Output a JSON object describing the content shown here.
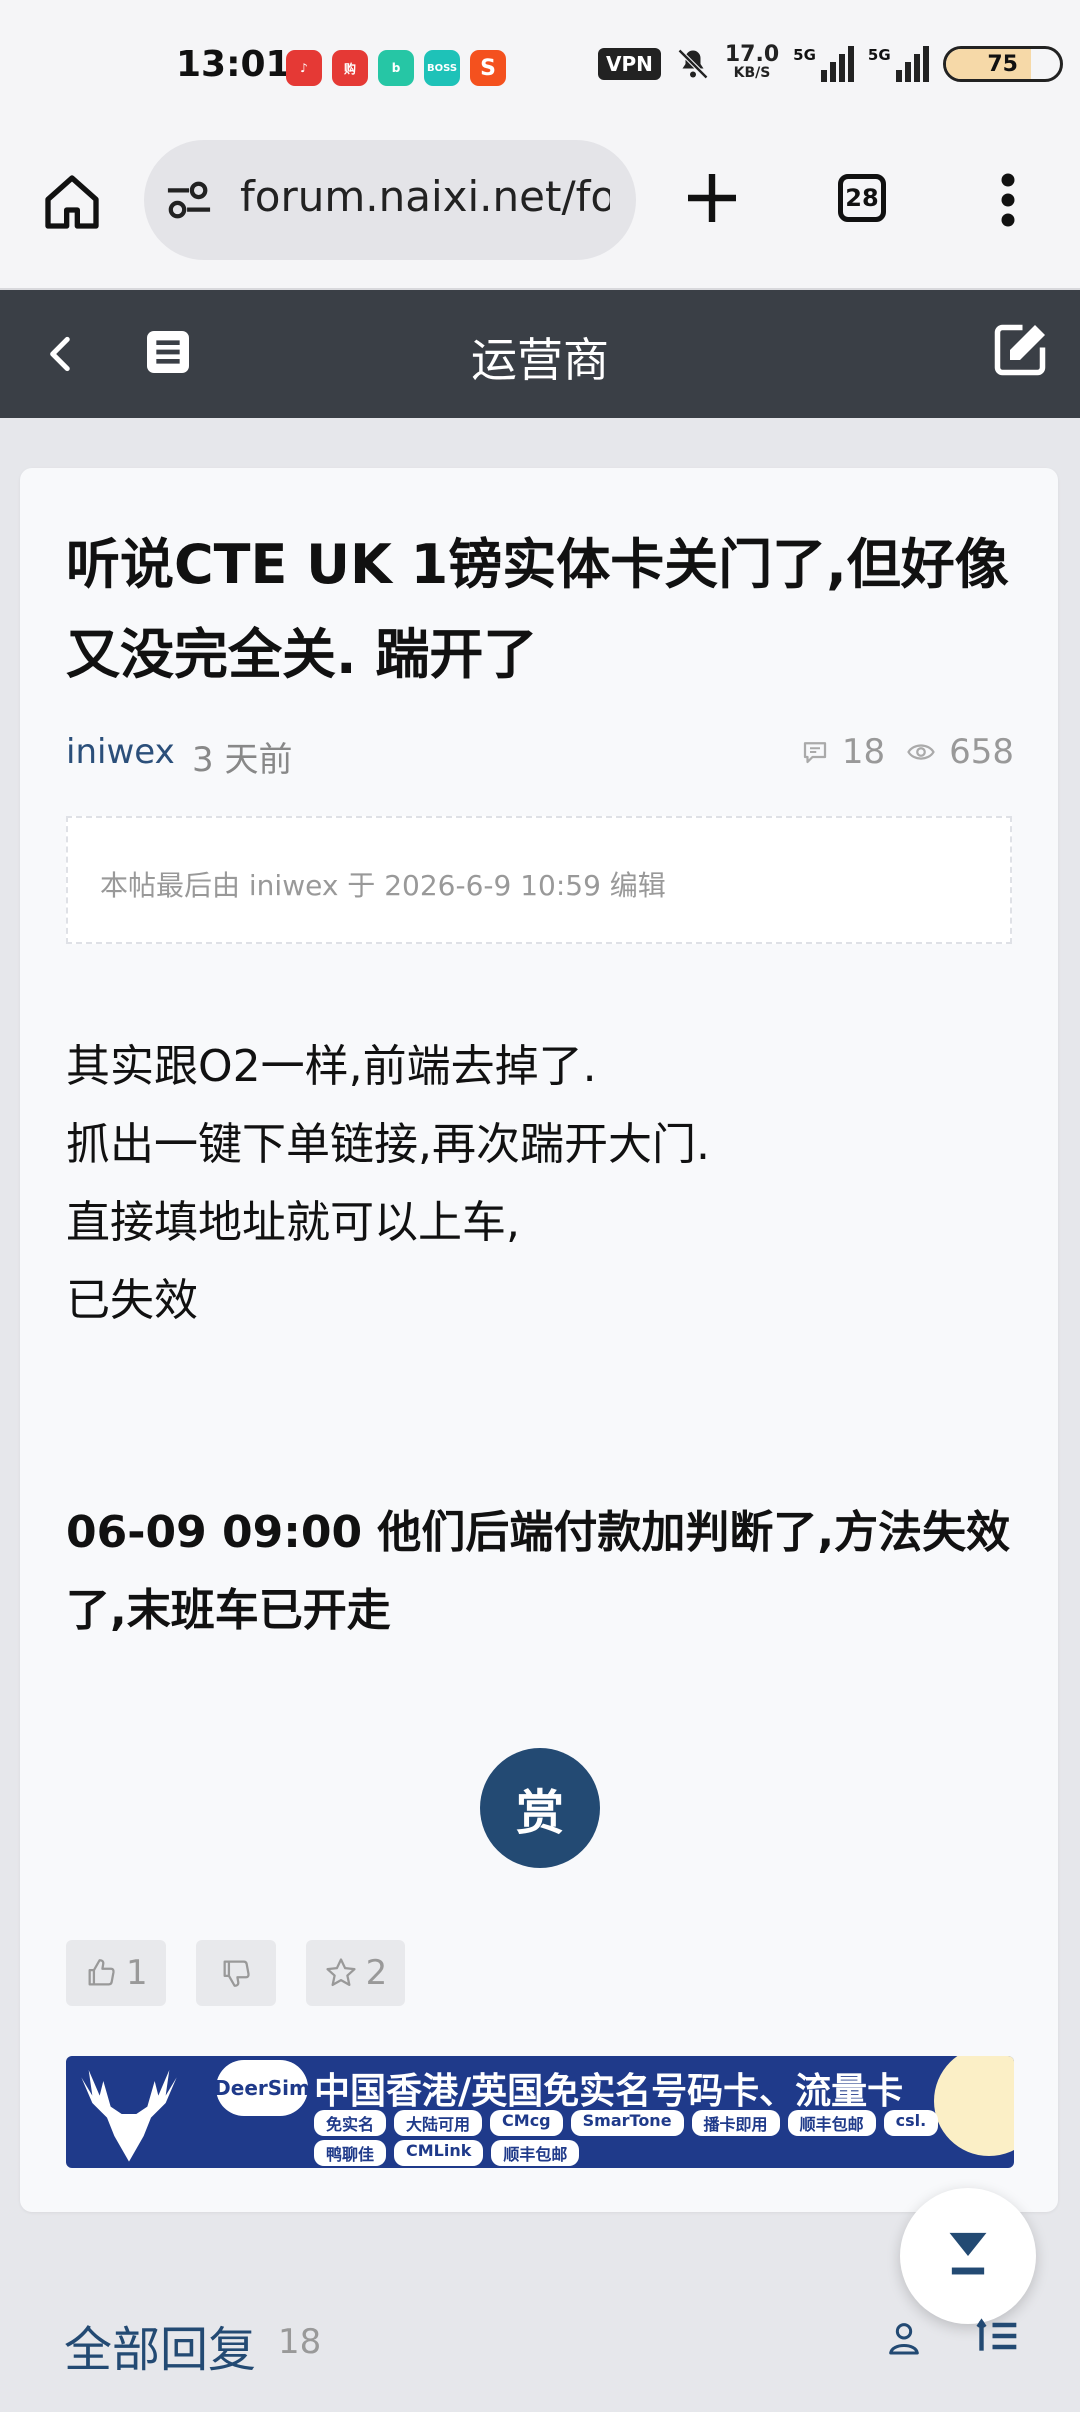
{
  "status_bar": {
    "time": "13:01",
    "apps": [
      {
        "icon": "music-app-icon",
        "color": "#e53935",
        "label": "♪"
      },
      {
        "icon": "shopping-app-icon",
        "color": "#e53935",
        "label": "购"
      },
      {
        "icon": "bilibili-app-icon",
        "color": "#26c6a5",
        "label": "b"
      },
      {
        "icon": "boss-zhipin-app-icon",
        "color": "#1ec2b8",
        "label": "BOSS"
      },
      {
        "icon": "sogou-app-icon",
        "color": "#f4511e",
        "label": "S"
      }
    ],
    "vpn": "VPN",
    "speed_value": "17.0",
    "speed_unit": "KB/S",
    "signal1_label": "5G",
    "signal2_label": "5G",
    "battery": "75",
    "battery_fraction": 0.75
  },
  "browser": {
    "url": "forum.naixi.net/fo",
    "tab_count": "28"
  },
  "forum_header": {
    "title": "运营商"
  },
  "post": {
    "title": "听说CTE UK 1镑实体卡关门了,但好像又没完全关. 踹开了",
    "author": "iniwex",
    "time": "3 天前",
    "comments": "18",
    "views": "658",
    "edit_note": "本帖最后由 iniwex 于 2026-6-9 10:59 编辑",
    "body_lines": [
      "其实跟O2一样,前端去掉了.",
      "抓出一键下单链接,再次踹开大门.",
      "直接填地址就可以上车,",
      "已失效"
    ],
    "bold_paragraph": "06-09 09:00 他们后端付款加判断了,方法失效了,末班车已开走",
    "reward_label": "赏",
    "likes": "1",
    "favorites": "2"
  },
  "banner": {
    "brand": "DeerSim",
    "headline": "中国香港/英国免实名号码卡、流量卡",
    "pills": [
      "免实名",
      "大陆可用",
      "CMcg",
      "SmarTone",
      "播卡即用",
      "顺丰包邮",
      "csl.",
      "鸭聊佳",
      "CMLink",
      "顺丰包邮"
    ]
  },
  "replies": {
    "title": "全部回复",
    "count": "18"
  }
}
